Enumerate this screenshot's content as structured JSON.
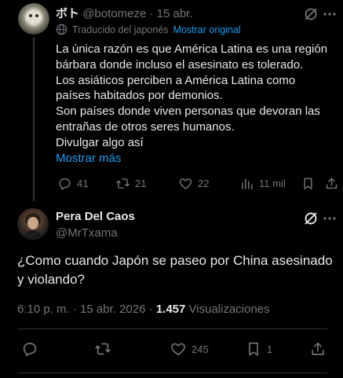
{
  "parent_tweet": {
    "author_name": "ボト",
    "author_handle": "@botomeze",
    "separator": "·",
    "date": "15 abr.",
    "translated_label": "Traducido del japonés",
    "show_original_label": "Mostrar original",
    "text_lines": [
      "La única razón es que América Latina es una región",
      "bárbara donde incluso el asesinato es tolerado.",
      "Los asiáticos perciben a América Latina como",
      "países habitados por demonios.",
      "Son países donde viven personas que devoran las",
      "entrañas de otros seres humanos.",
      "Divulgar algo así"
    ],
    "show_more_label": "Mostrar más",
    "replies": "41",
    "reposts": "21",
    "likes": "22",
    "views": "11 mil"
  },
  "main_tweet": {
    "author_name": "Pera Del Caos",
    "author_handle": "@MrTxama",
    "text_lines": [
      "¿Como cuando Japón se paseo por China asesinado",
      "y violando?"
    ],
    "time": "6:10 p. m.",
    "separator": "·",
    "date": "15 abr. 2026",
    "views_count": "1.457",
    "views_label": "Visualizaciones",
    "replies": "",
    "reposts": "",
    "likes": "245",
    "bookmarks": "1"
  },
  "icons": {
    "reply": "reply-icon",
    "repost": "repost-icon",
    "like": "heart-icon",
    "views": "views-icon",
    "bookmark": "bookmark-icon",
    "share": "share-icon",
    "grok": "grok-icon",
    "more": "more-icon",
    "translate": "globe-icon"
  },
  "colors": {
    "background": "#000000",
    "text": "#e7e9ea",
    "muted": "#71767b",
    "accent": "#1d9bf0",
    "divider": "#2f3336"
  }
}
